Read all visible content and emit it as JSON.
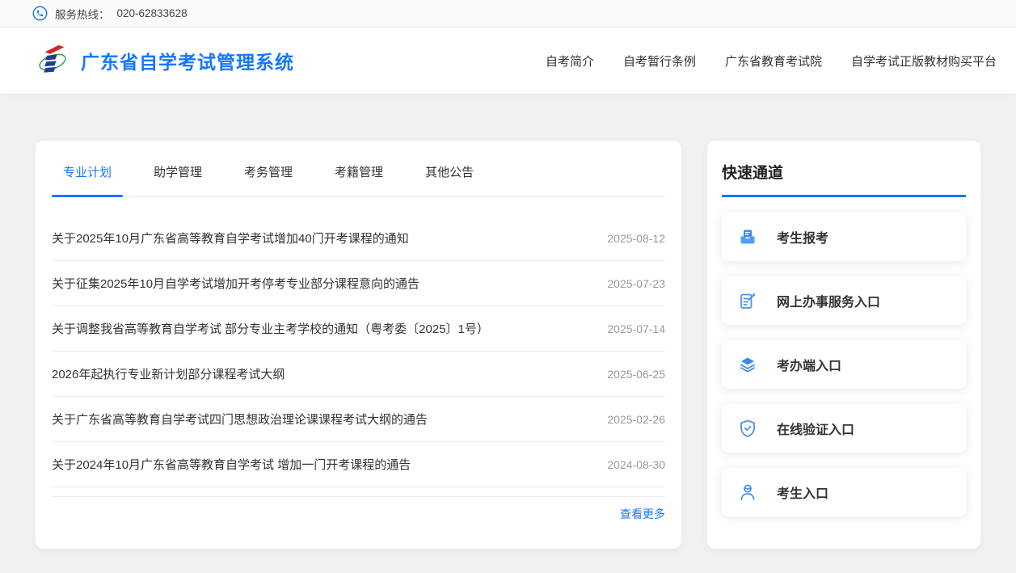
{
  "topbar": {
    "hotline_label": "服务热线：",
    "hotline_number": "020-62833628"
  },
  "header": {
    "title": "广东省自学考试管理系统",
    "nav": [
      {
        "label": "自考简介"
      },
      {
        "label": "自考暂行条例"
      },
      {
        "label": "广东省教育考试院"
      },
      {
        "label": "自学考试正版教材购买平台"
      }
    ]
  },
  "main": {
    "tabs": [
      {
        "label": "专业计划",
        "active": true
      },
      {
        "label": "助学管理",
        "active": false
      },
      {
        "label": "考务管理",
        "active": false
      },
      {
        "label": "考籍管理",
        "active": false
      },
      {
        "label": "其他公告",
        "active": false
      }
    ],
    "news": [
      {
        "title": "关于2025年10月广东省高等教育自学考试增加40门开考课程的通知",
        "date": "2025-08-12"
      },
      {
        "title": "关于征集2025年10月自学考试增加开考停考专业部分课程意向的通告",
        "date": "2025-07-23"
      },
      {
        "title": "关于调整我省高等教育自学考试 部分专业主考学校的通知（粤考委〔2025〕1号）",
        "date": "2025-07-14"
      },
      {
        "title": "2026年起执行专业新计划部分课程考试大纲",
        "date": "2025-06-25"
      },
      {
        "title": "关于广东省高等教育自学考试四门思想政治理论课课程考试大纲的通告",
        "date": "2025-02-26"
      },
      {
        "title": "关于2024年10月广东省高等教育自学考试 增加一门开考课程的通告",
        "date": "2024-08-30"
      }
    ],
    "view_more": "查看更多"
  },
  "sidebar": {
    "title": "快速通道",
    "items": [
      {
        "label": "考生报考",
        "icon": "inbox-icon"
      },
      {
        "label": "网上办事服务入口",
        "icon": "form-edit-icon"
      },
      {
        "label": "考办端入口",
        "icon": "layers-icon"
      },
      {
        "label": "在线验证入口",
        "icon": "shield-check-icon"
      },
      {
        "label": "考生入口",
        "icon": "user-icon"
      }
    ]
  },
  "colors": {
    "accent": "#1677ff",
    "icon_blue": "#4b94ea",
    "icon_blue_strong": "#3d87ee",
    "logo_red": "#d8232a",
    "logo_navy": "#1d3f94",
    "logo_green": "#2f9e4e",
    "date_gray": "#999999",
    "text_dark": "#333333"
  }
}
